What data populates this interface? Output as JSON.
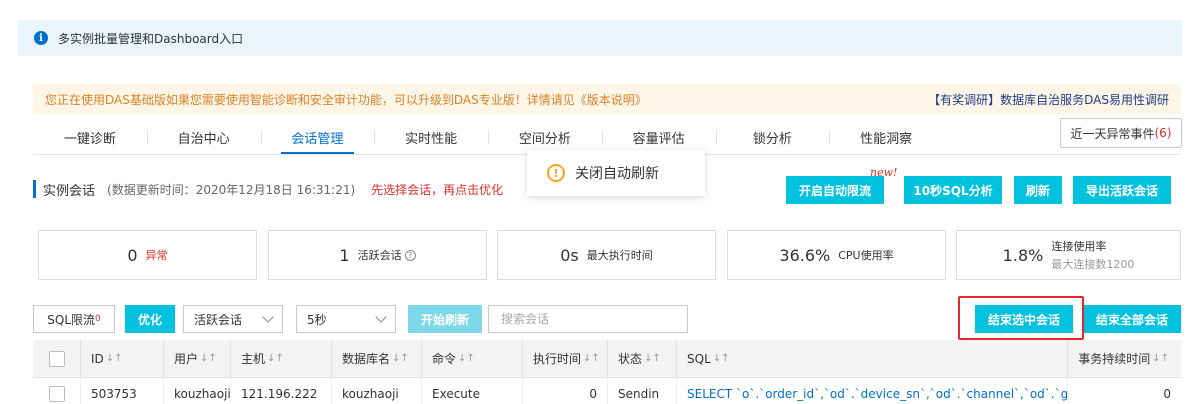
{
  "info_bar": {
    "text": "多实例批量管理和Dashboard入口"
  },
  "notice": {
    "left": "您正在使用DAS基础版如果您需要使用智能诊断和安全审计功能，可以升级到DAS专业版！详情请见《版本说明》",
    "right": "【有奖调研】数据库自治服务DAS易用性调研"
  },
  "tabs": [
    "一键诊断",
    "自治中心",
    "会话管理",
    "实时性能",
    "空间分析",
    "容量评估",
    "锁分析",
    "性能洞察"
  ],
  "active_tab": "会话管理",
  "anomaly_button": {
    "label": "近一天异常事件",
    "count": "(6)"
  },
  "tooltip": {
    "text": "关闭自动刷新"
  },
  "section": {
    "title": "实例会话",
    "update_time": "(数据更新时间：2020年12月18日 16:31:21)",
    "hint": "先选择会话，再点击优化"
  },
  "action_buttons": {
    "auto_limit": "开启自动限流",
    "new_badge": "new!",
    "sql_analysis": "10秒SQL分析",
    "refresh": "刷新",
    "export": "导出活跃会话"
  },
  "stats": {
    "abnormal": {
      "value": "0",
      "label": "异常"
    },
    "active": {
      "value": "1",
      "label": "活跃会话"
    },
    "max_exec": {
      "value": "0s",
      "label": "最大执行时间"
    },
    "cpu": {
      "value": "36.6%",
      "label": "CPU使用率"
    },
    "conn": {
      "value": "1.8%",
      "label": "连接使用率",
      "sub": "最大连接数1200"
    }
  },
  "toolbar": {
    "sql_limit": "SQL限流",
    "sql_limit_count": "0",
    "optimize": "优化",
    "session_filter": "活跃会话",
    "interval": "5秒",
    "start_refresh": "开始刷新",
    "search_placeholder": "搜索会话",
    "end_selected": "结束选中会话",
    "end_all": "结束全部会话"
  },
  "table": {
    "columns": [
      "ID",
      "用户",
      "主机",
      "数据库名",
      "命令",
      "执行时间",
      "状态",
      "SQL",
      "事务持续时间"
    ],
    "rows": [
      [
        "503753",
        "kouzhaoji",
        "121.196.222",
        "kouzhaoji",
        "Execute",
        "0",
        "Sendin",
        "SELECT `o`.`order_id`,`od`.`device_sn`,`od`.`channel`,`od`.`goodid`,`o",
        "0"
      ]
    ]
  },
  "colors": {
    "accent": "#0070cc",
    "button": "#00c1de",
    "danger": "#d93026",
    "highlight": "#e8262b"
  }
}
